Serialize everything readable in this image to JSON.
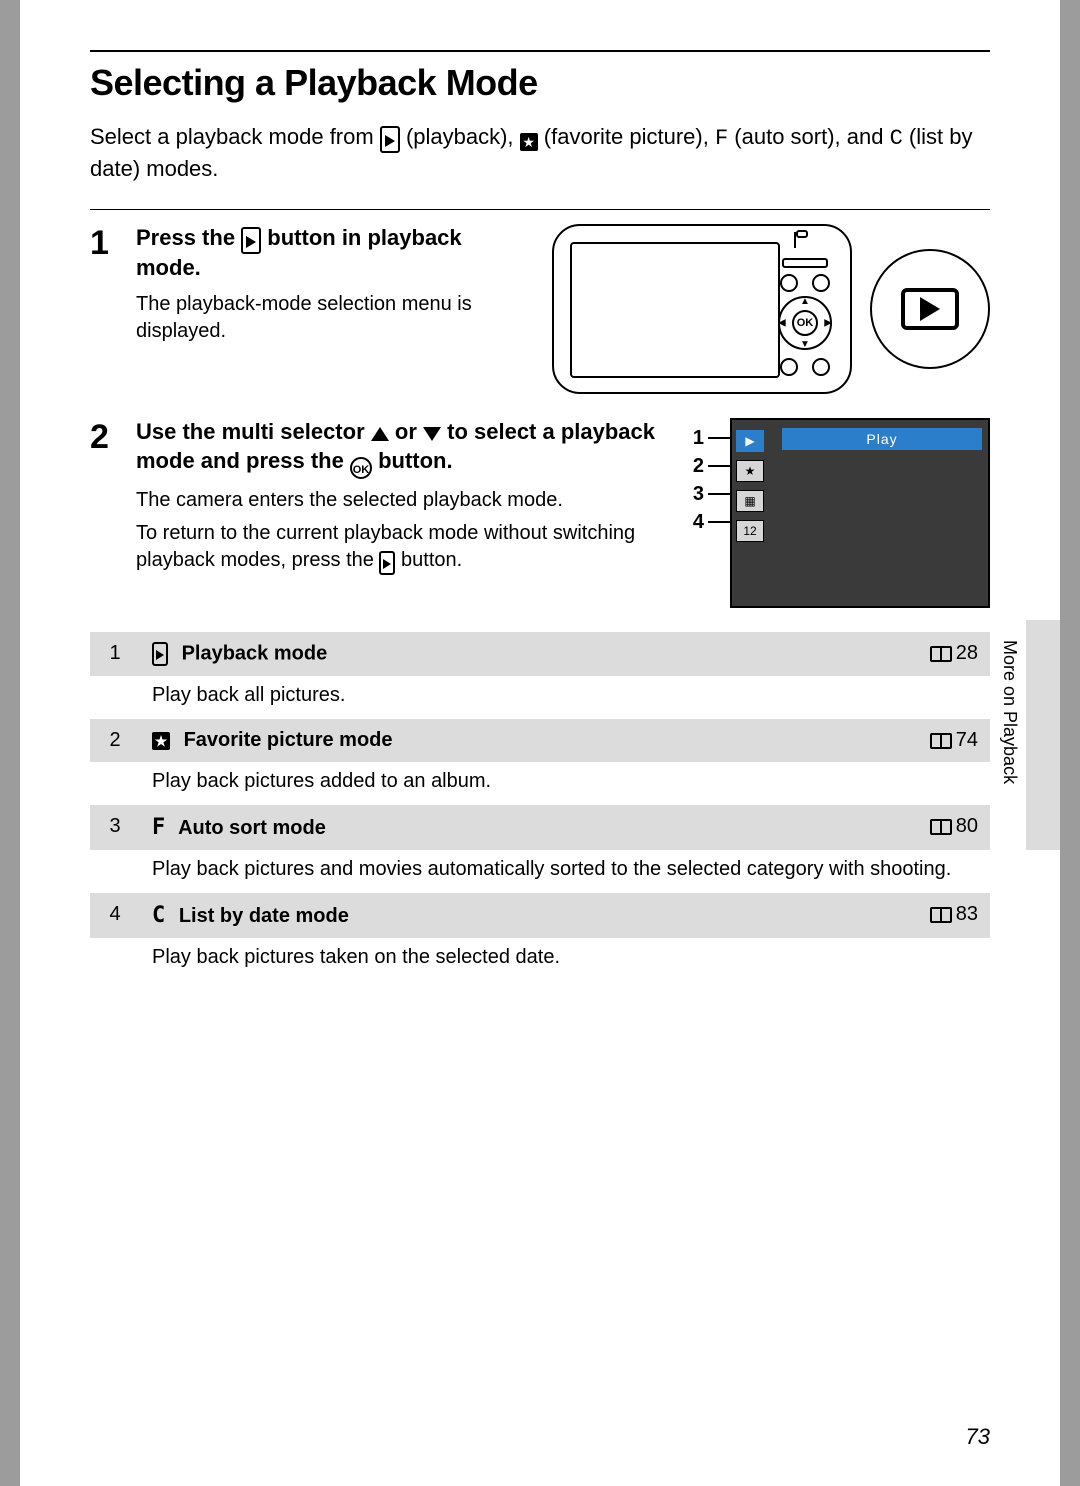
{
  "title": "Selecting a Playback Mode",
  "intro_parts": {
    "p1": "Select a playback mode from ",
    "p2": " (playback), ",
    "p3": " (favorite picture), ",
    "p4": " (auto sort), and ",
    "p5": " (list by date) modes.",
    "sym_f": "F",
    "sym_c": "C"
  },
  "steps": {
    "s1": {
      "num": "1",
      "head_a": "Press the ",
      "head_b": " button in playback mode.",
      "sub": "The playback-mode selection menu is displayed."
    },
    "s2": {
      "num": "2",
      "head_a": "Use the multi selector ",
      "head_b": " or ",
      "head_c": " to select a playback mode and press the ",
      "head_d": " button.",
      "sub1": "The camera enters the selected playback mode.",
      "sub2_a": "To return to the current playback mode without switching playback modes, press the ",
      "sub2_b": " button."
    }
  },
  "lcd_menu": {
    "topbar": "Play",
    "labels": [
      "1",
      "2",
      "3",
      "4"
    ],
    "icons": [
      "▶",
      "★",
      "▦",
      "12"
    ]
  },
  "ok_label": "OK",
  "modes": [
    {
      "num": "1",
      "icon_type": "play",
      "name": "Playback mode",
      "page": "28",
      "desc": "Play back all pictures."
    },
    {
      "num": "2",
      "icon_type": "star",
      "name": "Favorite picture mode",
      "page": "74",
      "desc": "Play back pictures added to an album."
    },
    {
      "num": "3",
      "icon_type": "F",
      "name": "Auto sort mode",
      "page": "80",
      "desc": "Play back pictures and movies automatically sorted to the selected category with shooting."
    },
    {
      "num": "4",
      "icon_type": "C",
      "name": "List by date mode",
      "page": "83",
      "desc": "Play back pictures taken on the selected date."
    }
  ],
  "side_label": "More on Playback",
  "page_number": "73"
}
